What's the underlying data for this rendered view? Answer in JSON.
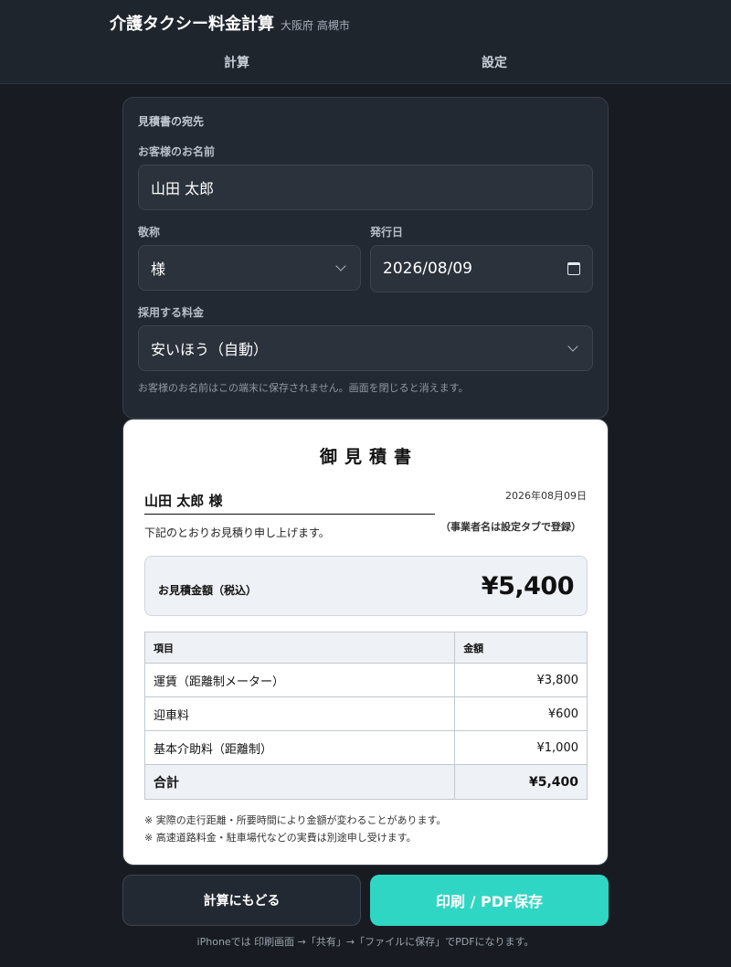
{
  "header": {
    "title": "介護タクシー料金計算",
    "region": "大阪府 高槻市",
    "tabs": [
      {
        "label": "計算"
      },
      {
        "label": "設定"
      }
    ]
  },
  "form": {
    "section_title": "見積書の宛先",
    "name_label": "お客様のお名前",
    "name_value": "山田 太郎",
    "honorific_label": "敬称",
    "honorific_value": "様",
    "date_label": "発行日",
    "date_value": "2026/08/09",
    "rate_label": "採用する料金",
    "rate_value": "安いほう（自動）",
    "note": "お客様のお名前はこの端末に保存されません。画面を閉じると消えます。"
  },
  "estimate": {
    "title": "御見積書",
    "recipient": "山田 太郎 様",
    "issue_date": "2026年08月09日",
    "intro": "下記のとおりお見積り申し上げます。",
    "provider_note": "（事業者名は設定タブで登録）",
    "total_label": "お見積金額（税込）",
    "total_amount": "¥5,400",
    "table": {
      "headers": [
        "項目",
        "金額"
      ],
      "rows": [
        {
          "item": "運賃（距離制メーター）",
          "amount": "¥3,800"
        },
        {
          "item": "迎車料",
          "amount": "¥600"
        },
        {
          "item": "基本介助料（距離制）",
          "amount": "¥1,000"
        }
      ],
      "sum_label": "合計",
      "sum_amount": "¥5,400"
    },
    "remarks": [
      "※ 実際の走行距離・所要時間により金額が変わることがあります。",
      "※ 高速道路料金・駐車場代などの実費は別途申し受けます。"
    ]
  },
  "actions": {
    "back_label": "計算にもどる",
    "print_label": "印刷 / PDF保存",
    "hint": "iPhoneでは 印刷画面 →「共有」→「ファイルに保存」でPDFになります。"
  },
  "colors": {
    "background": "#181c22",
    "accent": "#2fd6c3"
  }
}
